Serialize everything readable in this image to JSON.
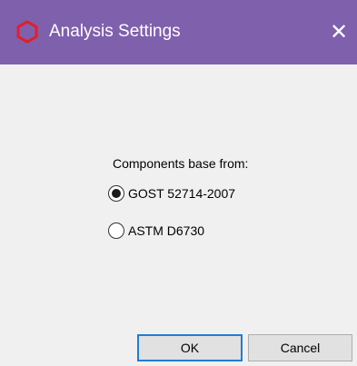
{
  "window": {
    "title": "Analysis Settings",
    "title_bar_color": "#7f60ad",
    "app_icon": "red-hexagon-icon",
    "close_glyph": "✕"
  },
  "content": {
    "group_label": "Components base from:",
    "options": [
      {
        "label": "GOST 52714-2007",
        "selected": true
      },
      {
        "label": "ASTM D6730",
        "selected": false
      }
    ]
  },
  "buttons": {
    "ok_label": "OK",
    "cancel_label": "Cancel"
  },
  "colors": {
    "accent": "#1f7ed2",
    "icon": "#e0202a",
    "background": "#f0f0f0"
  }
}
